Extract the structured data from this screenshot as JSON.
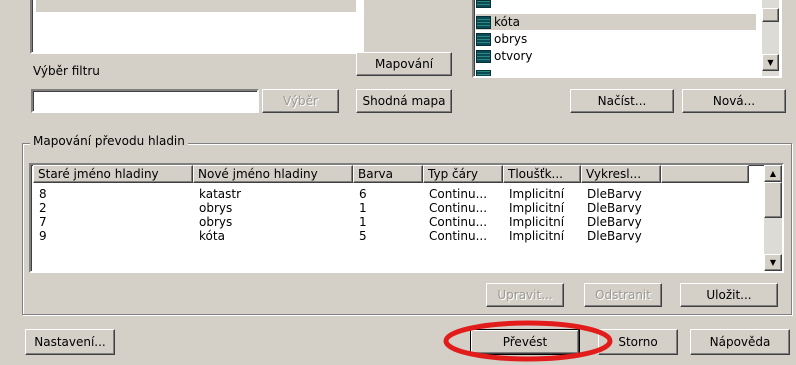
{
  "filter": {
    "label": "Výběr filtru",
    "input_value": "",
    "select_button": "Výběr"
  },
  "middle_buttons": {
    "mapping": "Mapování",
    "same_map": "Shodná mapa"
  },
  "layer_list": {
    "items": [
      "kóta",
      "obrys",
      "otvory"
    ],
    "selected_index": 0
  },
  "right_buttons": {
    "load": "Načíst...",
    "new": "Nová..."
  },
  "mapping_group": {
    "title": "Mapování převodu hladin",
    "columns": [
      "Staré jméno hladiny",
      "Nové jméno hladiny",
      "Barva",
      "Typ čáry",
      "Tloušťk...",
      "Vykresl..."
    ],
    "rows": [
      [
        "8",
        "katastr",
        "6",
        "Continu...",
        "Implicitní",
        "DleBarvy"
      ],
      [
        "2",
        "obrys",
        "1",
        "Continu...",
        "Implicitní",
        "DleBarvy"
      ],
      [
        "7",
        "obrys",
        "1",
        "Continu...",
        "Implicitní",
        "DleBarvy"
      ],
      [
        "9",
        "kóta",
        "5",
        "Continu...",
        "Implicitní",
        "DleBarvy"
      ]
    ],
    "edit_button": "Upravit...",
    "remove_button": "Odstranit",
    "save_button": "Uložit..."
  },
  "bottom_buttons": {
    "settings": "Nastavení...",
    "convert": "Převést",
    "cancel": "Storno",
    "help": "Nápověda"
  },
  "highlight_color": "#e21b1b"
}
